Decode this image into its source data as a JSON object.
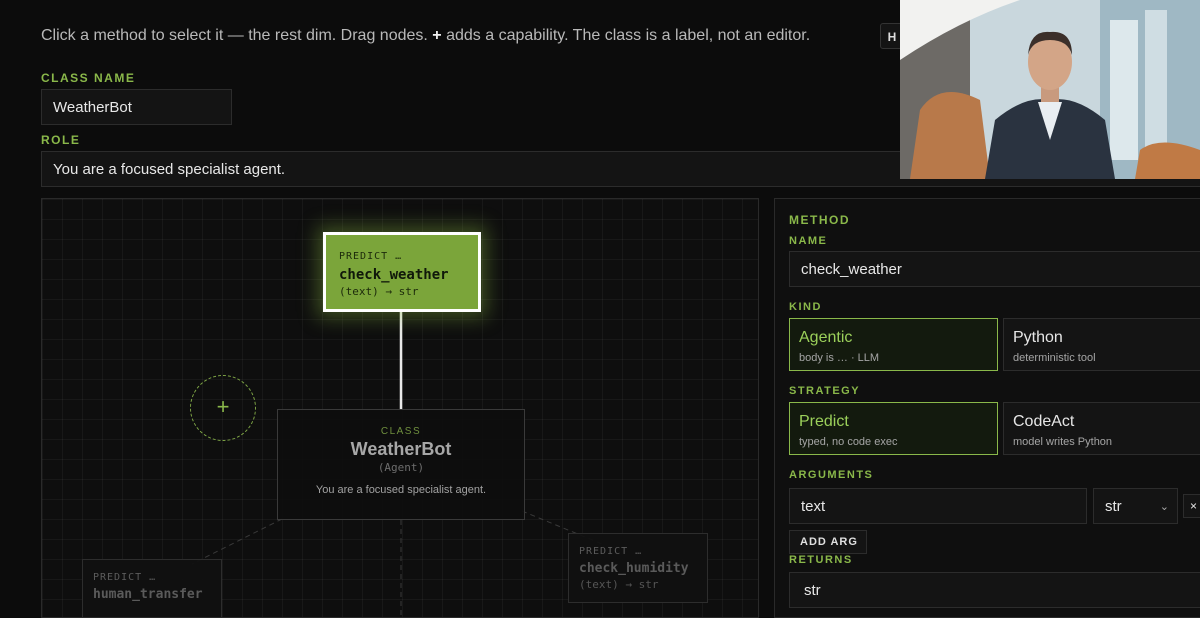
{
  "hint": {
    "before": "Click a method to select it — the rest dim. Drag nodes.",
    "plus": "+",
    "after": "adds a capability. The class is a label, not an editor."
  },
  "help_button": {
    "label": "H"
  },
  "class_name": {
    "label": "CLASS NAME",
    "value": "WeatherBot"
  },
  "role": {
    "label": "ROLE",
    "value": "You are a focused specialist agent."
  },
  "canvas": {
    "add_capability": "+",
    "selected_node": {
      "kind": "PREDICT …",
      "name": "check_weather",
      "signature": "(text) → str"
    },
    "class_node": {
      "kind": "CLASS",
      "name": "WeatherBot",
      "type": "(Agent)",
      "role": "You are a focused specialist agent."
    },
    "nodes": [
      {
        "kind": "PREDICT …",
        "name": "human_transfer",
        "signature": ""
      },
      {
        "kind": "PREDICT …",
        "name": "check_humidity",
        "signature": "(text) → str"
      }
    ]
  },
  "method_panel": {
    "title": "METHOD",
    "name_label": "NAME",
    "name_value": "check_weather",
    "kind_label": "KIND",
    "kind_options": [
      {
        "title": "Agentic",
        "subtitle": "body is … · LLM",
        "selected": true
      },
      {
        "title": "Python",
        "subtitle": "deterministic tool",
        "selected": false
      }
    ],
    "strategy_label": "STRATEGY",
    "strategy_options": [
      {
        "title": "Predict",
        "subtitle": "typed, no code exec",
        "selected": true
      },
      {
        "title": "CodeAct",
        "subtitle": "model writes Python",
        "selected": false
      }
    ],
    "arguments_label": "ARGUMENTS",
    "arguments": [
      {
        "name": "text",
        "type": "str"
      }
    ],
    "remove_arg": "×",
    "add_arg": "ADD ARG",
    "returns_label": "RETURNS",
    "returns_value": "str"
  },
  "colors": {
    "accent": "#8ab84a",
    "selected_node": "#7ba53a",
    "background": "#0c0c0c"
  },
  "video_overlay": {
    "description": "presenter-webcam"
  }
}
